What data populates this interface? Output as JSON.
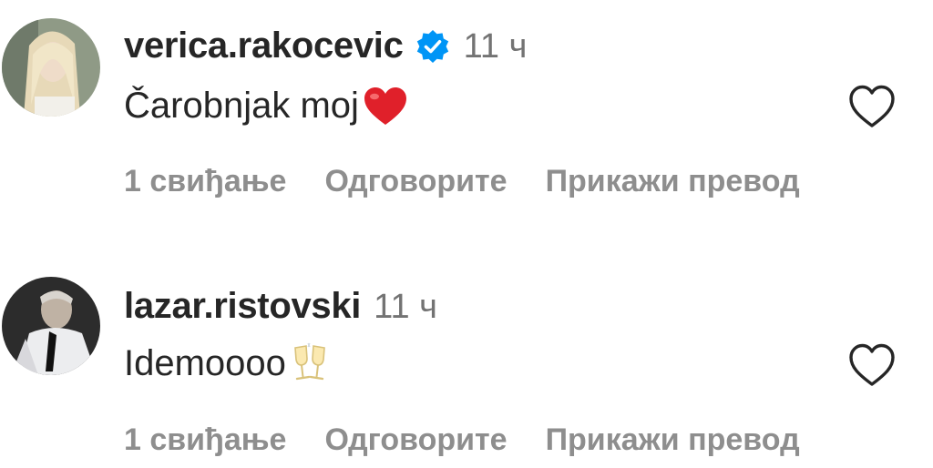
{
  "comments": [
    {
      "username": "verica.rakocevic",
      "verified": true,
      "time": "11 ч",
      "text": "Čarobnjak moj",
      "emoji": "red-heart",
      "likes_label": "1 свиђање",
      "reply_label": "Одговорите",
      "translate_label": "Прикажи превод"
    },
    {
      "username": "lazar.ristovski",
      "verified": false,
      "time": "11 ч",
      "text": "Idemoooo",
      "emoji": "clinking-glasses",
      "likes_label": "1 свиђање",
      "reply_label": "Одговорите",
      "translate_label": "Прикажи превод"
    }
  ],
  "colors": {
    "text": "#262626",
    "secondary": "#737373",
    "action": "#8e8e8e",
    "verified": "#0095f6",
    "heart_emoji": "#e0202a",
    "like_outline": "#262626"
  }
}
